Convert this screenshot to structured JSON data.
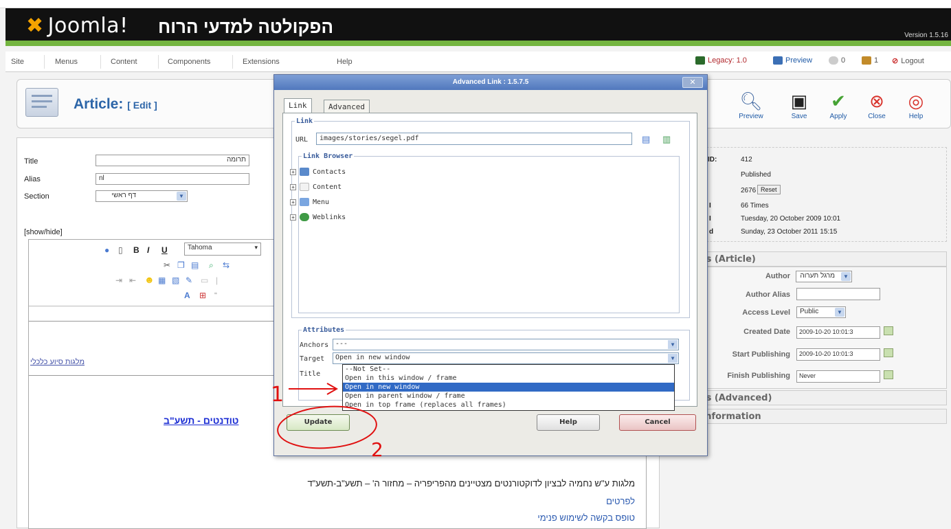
{
  "header": {
    "logo_text": "Joomla!",
    "site_name": "הפקולטה למדעי הרוח",
    "version": "Version 1.5.16"
  },
  "menu": {
    "items": [
      "Site",
      "Menus",
      "Content",
      "Components",
      "Extensions",
      "Help"
    ],
    "status": {
      "legacy": "Legacy: 1.0",
      "preview": "Preview",
      "messages": "0",
      "users": "1",
      "logout": "Logout"
    }
  },
  "toolbar": {
    "title": "Article:",
    "subtitle": "[ Edit ]",
    "buttons": [
      "Preview",
      "Save",
      "Apply",
      "Close",
      "Help"
    ]
  },
  "form": {
    "title_label": "Title",
    "title_value": "תרומה",
    "alias_label": "Alias",
    "alias_value": "nl",
    "section_label": "Section",
    "section_value": "דף ראשי",
    "showhide": "[show/hide]",
    "font_value": "Tahoma"
  },
  "editor": {
    "left_link": "מלגות סיוע כלכלי",
    "link_heading": "טודנטים - תשע\"ב",
    "line1": "מלגות ע\"ש נחמיה לבציון לדוקטורנטים מצטיינים מהפריפריה – מחזור ה' – תשע\"ב-תשע\"ד",
    "line2": "לפרטים",
    "line3": "טופס בקשה לשימוש פנימי"
  },
  "info": {
    "id_label": "ID:",
    "id": "412",
    "state": "Published",
    "hits": "2676",
    "reset": "Reset",
    "revised": "66 Times",
    "created": "Tuesday, 20 October 2009 10:01",
    "modified": "Sunday, 23 October 2011 15:15",
    "rev_frag": "d"
  },
  "params": {
    "heading": "ameters (Article)",
    "author_label": "Author",
    "author_value": "מרגל תערוה",
    "author_alias_label": "Author Alias",
    "access_label": "Access Level",
    "access_value": "Public",
    "created_label": "Created Date",
    "created_value": "2009-10-20 10:01:3",
    "start_label": "Start Publishing",
    "start_value": "2009-10-20 10:01:3",
    "finish_label": "Finish Publishing",
    "finish_value": "Never",
    "advanced": "ameters (Advanced)",
    "metadata": "adata Information"
  },
  "dialog": {
    "title": "Advanced Link : 1.5.7.5",
    "tab_link": "Link",
    "tab_advanced": "Advanced",
    "link_legend": "Link",
    "url_label": "URL",
    "url_value": "images/stories/segel.pdf",
    "browser_legend": "Link Browser",
    "tree": [
      "Contacts",
      "Content",
      "Menu",
      "Weblinks"
    ],
    "attributes_legend": "Attributes",
    "anchors_label": "Anchors",
    "anchors_value": "---",
    "target_label": "Target",
    "target_value": "Open in new window",
    "title_label": "Title",
    "target_options": [
      "--Not Set--",
      "Open in this window / frame",
      "Open in new window",
      "Open in parent window / frame",
      "Open in top frame (replaces all frames)"
    ],
    "update": "Update",
    "help": "Help",
    "cancel": "Cancel"
  },
  "annotations": {
    "one": "1",
    "two": "2"
  }
}
